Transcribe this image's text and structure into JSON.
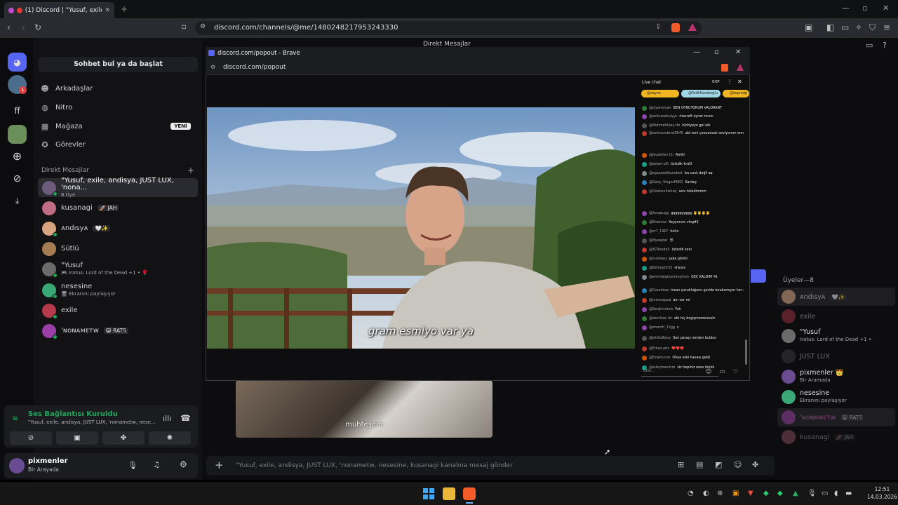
{
  "browser": {
    "tab_title": "(1) Discord | \"Yusuf, exile, an",
    "url": "discord.com/channels/@me/1480248217953243330",
    "new_tab_icon": "plus-icon"
  },
  "discord": {
    "header_title": "Direkt Mesajlar",
    "search_placeholder": "Sohbet bul ya da başlat",
    "nav": [
      {
        "label": "Arkadaşlar",
        "icon": "friends-icon"
      },
      {
        "label": "Nitro",
        "icon": "nitro-icon"
      },
      {
        "label": "Mağaza",
        "icon": "shop-icon",
        "badge": "YENİ"
      },
      {
        "label": "Görevler",
        "icon": "quests-icon"
      }
    ],
    "dm_header": "Direkt Mesajlar",
    "dms": [
      {
        "name": "\"Yusuf, exile, andisya, JUST LUX, 'nona...",
        "sub": "8 Üye",
        "color": "#6c5b7b"
      },
      {
        "name": "kusanagi",
        "tag": "🚀 JAH",
        "color": "#c06c84"
      },
      {
        "name": "ᴀndısyᴀ",
        "tag": "🤍✨",
        "color": "#d8a47f"
      },
      {
        "name": "Sütlü",
        "color": "#a67c52"
      },
      {
        "name": "\"Yusuf",
        "sub": "🎮 Iratus: Lord of the Dead +1 • 🌹",
        "color": "#6b6b6b"
      },
      {
        "name": "nesesine",
        "sub": "🖥 Ekranını paylaşıyor",
        "color": "#3aa776"
      },
      {
        "name": "exile",
        "color": "#b53a4b"
      },
      {
        "name": "'ɴoɴᴀᴍᴇᴛᴡ",
        "tag": "😸 RATS",
        "color": "#9b3fa6"
      }
    ],
    "voice": {
      "status": "Ses Bağlantısı Kuruldu",
      "channel": "\"Yusuf, exile, andisya, JUST LUX, 'nonametw, nese..."
    },
    "user": {
      "name": "pixmenler",
      "status": "Bir Arayada"
    },
    "composer_placeholder": "\"Yusuf, exile, andisya, JUST LUX, 'nonametw, nesesine, kusanagi kanalına mesaj gönder",
    "video_caption": "muhteşem",
    "members_header": "Üyeler—8",
    "members": [
      {
        "name": "ᴀndısyᴀ",
        "tag": "🤍✨",
        "dim": true,
        "color": "#d8a47f"
      },
      {
        "name": "exile",
        "dim": true,
        "color": "#b53a4b"
      },
      {
        "name": "\"Yusuf",
        "sub": "Iratus: Lord of the Dead +1 •",
        "color": "#6b6b6b"
      },
      {
        "name": "JUST LUX",
        "dim": true,
        "color": "#444"
      },
      {
        "name": "pixmenler 👑",
        "sub": "Bir Aramada",
        "color": "#6a4c93"
      },
      {
        "name": "nesesine",
        "sub": "Ekranını paylaşıyor",
        "color": "#3aa776"
      },
      {
        "name": "'ɴoɴᴀᴍᴇᴛᴡ",
        "tag": "😸 RATS",
        "dim": true,
        "color": "#9b3fa6"
      },
      {
        "name": "kusanagi",
        "tag": "🚀 JAH",
        "dim": true,
        "color": "#c06c84"
      }
    ]
  },
  "popup": {
    "title": "discord.com/popout - Brave",
    "url": "discord.com/popout",
    "caption": "gram esmiyo var ya",
    "chat": {
      "header": "Live chat",
      "points": "0XP",
      "input_placeholder": "Ekle...",
      "pinned": [
        "@aeyns",
        "@FatihKarakoglu",
        "@koprodp"
      ],
      "messages": [
        {
          "u": "@piyanoman",
          "t": "BEN OYNUYORUM VALORANT"
        },
        {
          "u": "@sehnasabulyys",
          "t": "macraft oynar mısın"
        },
        {
          "u": "@MehmetAkay-tfo",
          "t": "türkiyeye gel abi"
        },
        {
          "u": "@ozimaccderol9045",
          "t": "abi seni çoooooook seviyorum ennes abi"
        },
        {
          "u": "@Javalefan-t1i",
          "t": "Abiiiii"
        },
        {
          "u": "@selani-ufli",
          "t": "özledik kralll"
        },
        {
          "u": "@egazzeddiazsdeot",
          "t": "bu canlı değil aq"
        },
        {
          "u": "@Dairy_VlogssPKKD",
          "t": "Kardeş"
        },
        {
          "u": "@Qoohou3wheq",
          "t": "seni özledimmm"
        },
        {
          "u": "@iloxapugg",
          "t": "gggggggggg 🖐🖐🖐🖐"
        },
        {
          "u": "@Eloenisa",
          "t": "Yaşıyorum vlog#1"
        },
        {
          "u": "@or7_1967",
          "t": "hoho"
        },
        {
          "u": "@Mysaplar",
          "t": "😈"
        },
        {
          "u": "@XCRandeX",
          "t": "özledik seni"
        },
        {
          "u": "@molkeeq",
          "t": "şaka gibiiiii"
        },
        {
          "u": "@BerkayOr33",
          "t": "shssss"
        },
        {
          "u": "@emindegilcemreyimm",
          "t": "GEC KALDIM YA"
        },
        {
          "u": "@Cesarloas",
          "t": "insan çocukluğunu geride bırakamıyor her şeye rağmen burdasın iyiki varsın"
        },
        {
          "u": "@memogaza",
          "t": "anı var mi"
        },
        {
          "u": "@Sanjkhmmis",
          "t": "Yuh"
        },
        {
          "u": "@zenchee-rhi",
          "t": "abi hiç degişmemeisssin"
        },
        {
          "u": "@emerfrl_13gg",
          "t": "s"
        },
        {
          "u": "@JetttieBony",
          "t": "Sen parayı nerden buldun"
        },
        {
          "u": "@Erkan-pbx",
          "t": "❤️❤️❤️"
        },
        {
          "u": "@Eslamunss",
          "t": "Ohaa eski havası geldi"
        },
        {
          "u": "@ssleymanzcm",
          "t": "siz hepiniz enes tekkk"
        }
      ]
    }
  },
  "taskbar": {
    "time": "12:51",
    "date": "14.03.2026"
  }
}
